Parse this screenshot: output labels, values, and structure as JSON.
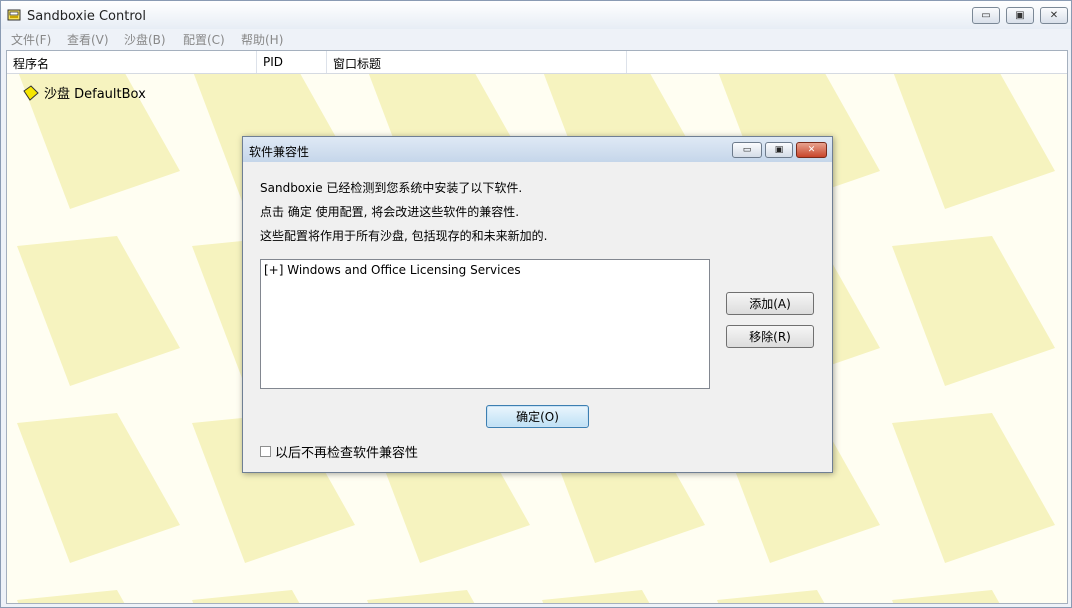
{
  "window": {
    "title": "Sandboxie Control",
    "controls": [
      "minimize-icon",
      "maximize-icon",
      "close-icon"
    ]
  },
  "menu": {
    "items": [
      "文件(F)",
      "查看(V)",
      "沙盘(B)",
      "配置(C)",
      "帮助(H)"
    ]
  },
  "list": {
    "columns": [
      "程序名",
      "PID",
      "窗口标题"
    ],
    "tree_item": "沙盘 DefaultBox",
    "tree_item_icon": "sandbox-icon"
  },
  "dialog": {
    "title": "软件兼容性",
    "messages": [
      "Sandboxie 已经检测到您系统中安装了以下软件.",
      "点击 确定 使用配置, 将会改进这些软件的兼容性.",
      "这些配置将作用于所有沙盘, 包括现存的和未来新加的."
    ],
    "software_items": [
      "[+]  Windows and Office Licensing Services"
    ],
    "add_label": "添加(A)",
    "remove_label": "移除(R)",
    "ok_label": "确定(O)",
    "checkbox_label": "以后不再检查软件兼容性",
    "checkbox_checked": false
  },
  "colors": {
    "pattern_fill": "#f6f3bf",
    "pattern_bg": "#fffef2",
    "close_red": "#c8452b"
  }
}
